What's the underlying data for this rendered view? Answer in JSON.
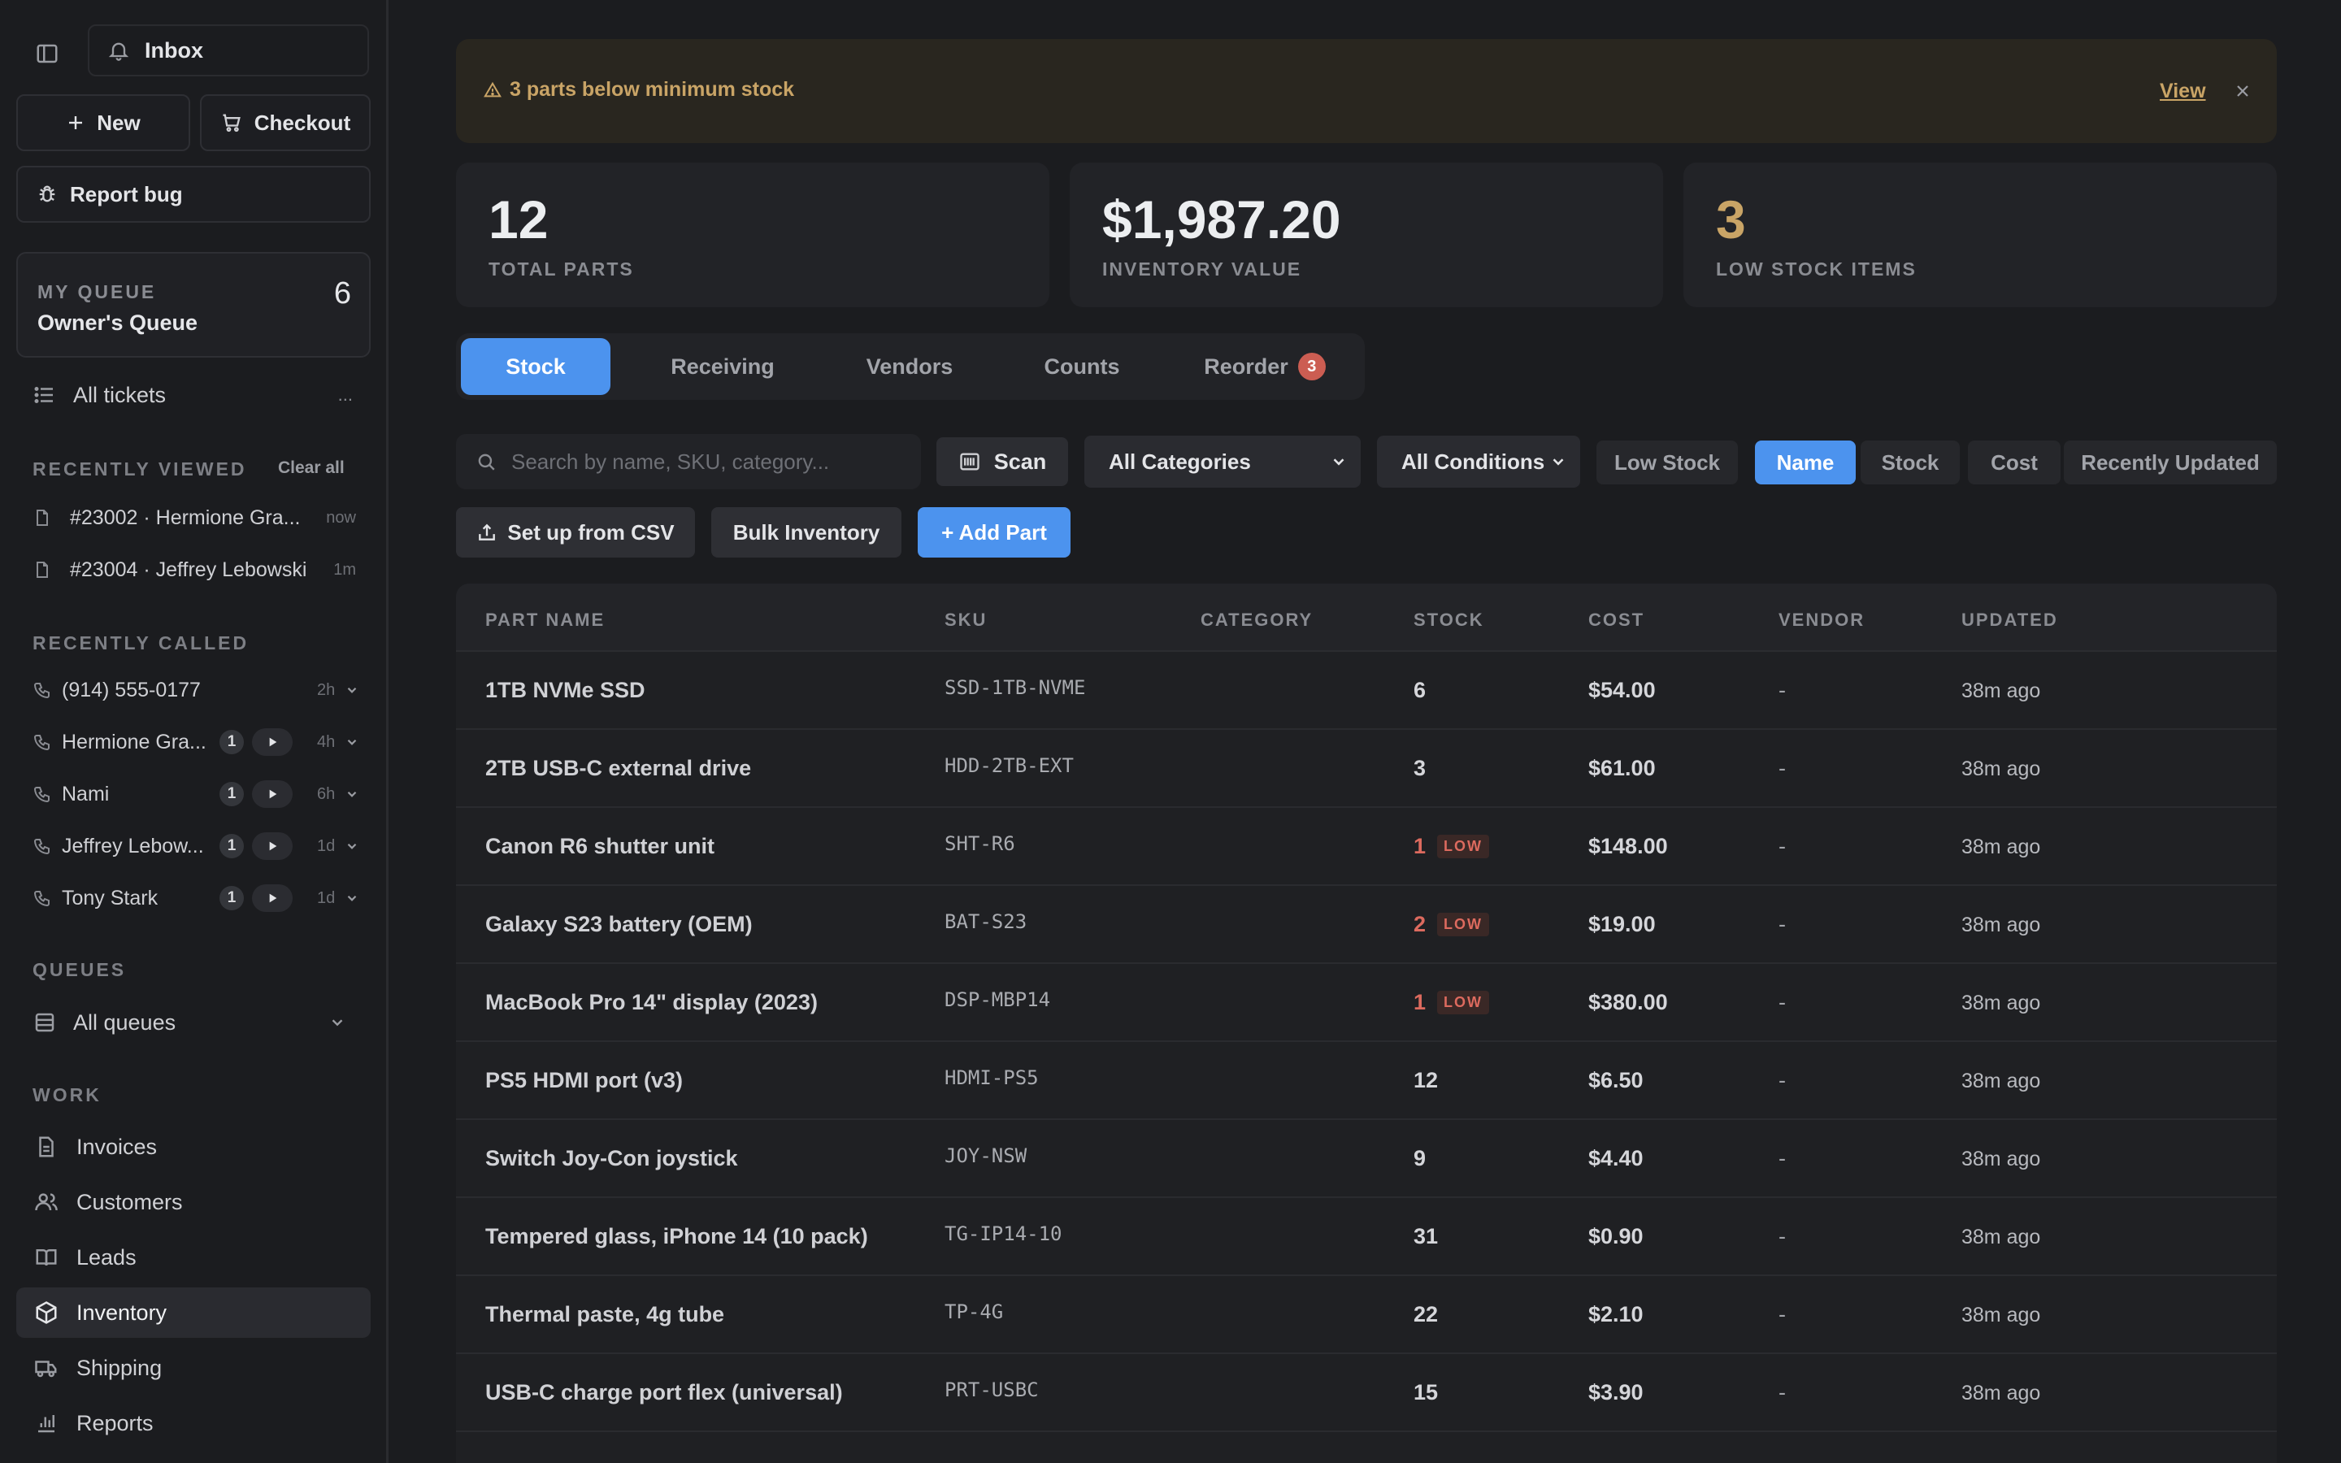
{
  "sidebar": {
    "inbox_label": "Inbox",
    "new_label": "New",
    "checkout_label": "Checkout",
    "report_bug_label": "Report bug",
    "my_queue": {
      "label": "MY QUEUE",
      "name": "Owner's Queue",
      "count": "6"
    },
    "all_tickets_label": "All tickets",
    "all_tickets_more": "...",
    "recently_viewed": {
      "label": "RECENTLY VIEWED",
      "clear_label": "Clear all",
      "items": [
        {
          "text": "#23002 · Hermione Gra...",
          "time": "now"
        },
        {
          "text": "#23004 · Jeffrey Lebowski",
          "time": "1m"
        }
      ]
    },
    "recently_called": {
      "label": "RECENTLY CALLED",
      "items": [
        {
          "name": "(914) 555-0177",
          "badge": "",
          "time": "2h"
        },
        {
          "name": "Hermione Gra...",
          "badge": "1",
          "time": "4h"
        },
        {
          "name": "Nami",
          "badge": "1",
          "time": "6h"
        },
        {
          "name": "Jeffrey Lebow...",
          "badge": "1",
          "time": "1d"
        },
        {
          "name": "Tony Stark",
          "badge": "1",
          "time": "1d"
        }
      ]
    },
    "queues": {
      "label": "QUEUES",
      "all_label": "All queues"
    },
    "work": {
      "label": "WORK",
      "items": [
        {
          "label": "Invoices",
          "icon": "file-icon"
        },
        {
          "label": "Customers",
          "icon": "users-icon"
        },
        {
          "label": "Leads",
          "icon": "book-icon"
        },
        {
          "label": "Inventory",
          "icon": "box-icon",
          "active": true
        },
        {
          "label": "Shipping",
          "icon": "truck-icon"
        },
        {
          "label": "Reports",
          "icon": "chart-icon"
        }
      ]
    }
  },
  "alert": {
    "message": "3 parts below minimum stock",
    "view_label": "View"
  },
  "stats": [
    {
      "value": "12",
      "label": "TOTAL PARTS"
    },
    {
      "value": "$1,987.20",
      "label": "INVENTORY VALUE"
    },
    {
      "value": "3",
      "label": "LOW STOCK ITEMS",
      "color": "#c9a466"
    }
  ],
  "tabs": [
    {
      "label": "Stock",
      "active": true
    },
    {
      "label": "Receiving"
    },
    {
      "label": "Vendors"
    },
    {
      "label": "Counts"
    },
    {
      "label": "Reorder",
      "badge": "3"
    }
  ],
  "toolbar": {
    "search_placeholder": "Search by name, SKU, category...",
    "scan_label": "Scan",
    "category_select": "All Categories",
    "condition_select": "All Conditions",
    "low_stock_label": "Low Stock",
    "sort_options": [
      "Name",
      "Stock",
      "Cost",
      "Recently Updated"
    ],
    "sort_active": "Name",
    "csv_label": "Set up from CSV",
    "bulk_label": "Bulk Inventory",
    "add_label": "+ Add Part"
  },
  "table": {
    "headers": [
      "PART NAME",
      "SKU",
      "CATEGORY",
      "STOCK",
      "COST",
      "VENDOR",
      "UPDATED"
    ],
    "low_tag": "LOW",
    "rows": [
      {
        "name": "1TB NVMe SSD",
        "sku": "SSD-1TB-NVME",
        "category": "",
        "stock": "6",
        "low": false,
        "cost": "$54.00",
        "vendor": "-",
        "updated": "38m ago"
      },
      {
        "name": "2TB USB-C external drive",
        "sku": "HDD-2TB-EXT",
        "category": "",
        "stock": "3",
        "low": false,
        "cost": "$61.00",
        "vendor": "-",
        "updated": "38m ago"
      },
      {
        "name": "Canon R6 shutter unit",
        "sku": "SHT-R6",
        "category": "",
        "stock": "1",
        "low": true,
        "cost": "$148.00",
        "vendor": "-",
        "updated": "38m ago"
      },
      {
        "name": "Galaxy S23 battery (OEM)",
        "sku": "BAT-S23",
        "category": "",
        "stock": "2",
        "low": true,
        "cost": "$19.00",
        "vendor": "-",
        "updated": "38m ago"
      },
      {
        "name": "MacBook Pro 14\" display (2023)",
        "sku": "DSP-MBP14",
        "category": "",
        "stock": "1",
        "low": true,
        "cost": "$380.00",
        "vendor": "-",
        "updated": "38m ago"
      },
      {
        "name": "PS5 HDMI port (v3)",
        "sku": "HDMI-PS5",
        "category": "",
        "stock": "12",
        "low": false,
        "cost": "$6.50",
        "vendor": "-",
        "updated": "38m ago"
      },
      {
        "name": "Switch Joy-Con joystick",
        "sku": "JOY-NSW",
        "category": "",
        "stock": "9",
        "low": false,
        "cost": "$4.40",
        "vendor": "-",
        "updated": "38m ago"
      },
      {
        "name": "Tempered glass, iPhone 14 (10 pack)",
        "sku": "TG-IP14-10",
        "category": "",
        "stock": "31",
        "low": false,
        "cost": "$0.90",
        "vendor": "-",
        "updated": "38m ago"
      },
      {
        "name": "Thermal paste, 4g tube",
        "sku": "TP-4G",
        "category": "",
        "stock": "22",
        "low": false,
        "cost": "$2.10",
        "vendor": "-",
        "updated": "38m ago"
      },
      {
        "name": "USB-C charge port flex (universal)",
        "sku": "PRT-USBC",
        "category": "",
        "stock": "15",
        "low": false,
        "cost": "$3.90",
        "vendor": "-",
        "updated": "38m ago"
      }
    ]
  }
}
